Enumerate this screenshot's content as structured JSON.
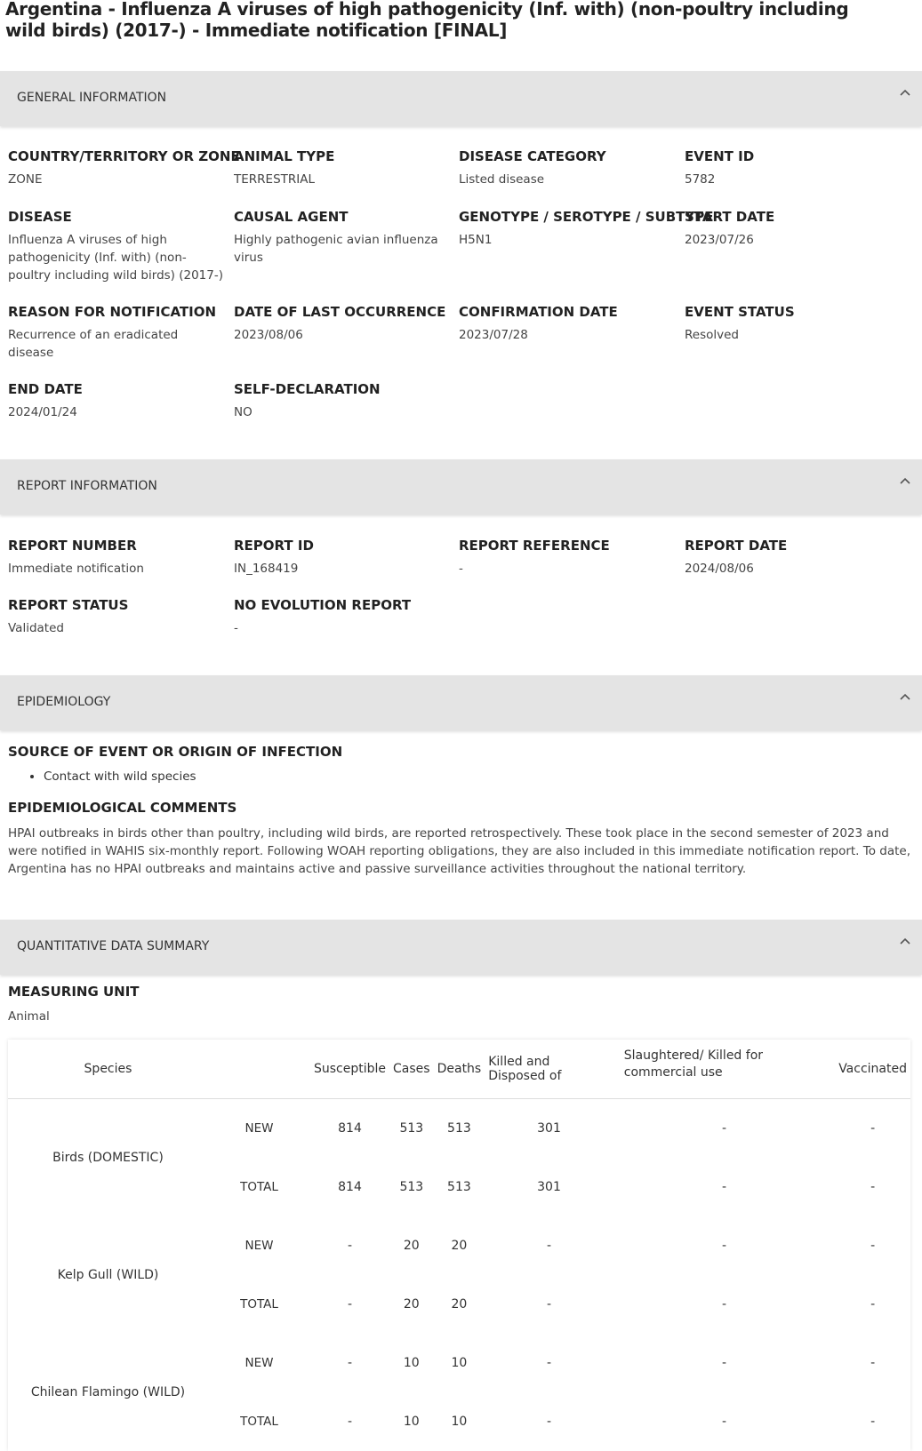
{
  "page": {
    "title": "Argentina - Influenza A viruses of high pathogenicity (Inf. with) (non-poultry including wild birds) (2017-) - Immediate notification [FINAL]"
  },
  "sections": {
    "general": "GENERAL INFORMATION",
    "report": "REPORT INFORMATION",
    "epidemiology": "EPIDEMIOLOGY",
    "quantitative": "QUANTITATIVE DATA SUMMARY"
  },
  "icons": {
    "collapse": "chevron-up-icon",
    "bullet": "bullet-icon"
  },
  "general": {
    "country_label": "COUNTRY/TERRITORY OR ZONE",
    "country_value": "ZONE",
    "animal_type_label": "ANIMAL TYPE",
    "animal_type_value": "TERRESTRIAL",
    "disease_category_label": "DISEASE CATEGORY",
    "disease_category_value": "Listed disease",
    "event_id_label": "EVENT ID",
    "event_id_value": "5782",
    "disease_label": "DISEASE",
    "disease_value": "Influenza A viruses of high pathogenicity (Inf. with) (non-poultry including wild birds) (2017-)",
    "causal_agent_label": "CAUSAL AGENT",
    "causal_agent_value": "Highly pathogenic avian influenza virus",
    "genotype_label": "GENOTYPE / SEROTYPE / SUBTYPE",
    "genotype_value": "H5N1",
    "start_date_label": "START DATE",
    "start_date_value": "2023/07/26",
    "reason_label": "REASON FOR NOTIFICATION",
    "reason_value": "Recurrence of an eradicated disease",
    "last_occurrence_label": "DATE OF LAST OCCURRENCE",
    "last_occurrence_value": "2023/08/06",
    "confirmation_label": "CONFIRMATION DATE",
    "confirmation_value": "2023/07/28",
    "event_status_label": "EVENT STATUS",
    "event_status_value": "Resolved",
    "end_date_label": "END DATE",
    "end_date_value": "2024/01/24",
    "self_declaration_label": "SELF-DECLARATION",
    "self_declaration_value": "NO"
  },
  "report": {
    "number_label": "REPORT NUMBER",
    "number_value": "Immediate notification",
    "id_label": "REPORT ID",
    "id_value": "IN_168419",
    "reference_label": "REPORT REFERENCE",
    "reference_value": "-",
    "date_label": "REPORT DATE",
    "date_value": "2024/08/06",
    "status_label": "REPORT STATUS",
    "status_value": "Validated",
    "no_evolution_label": "NO EVOLUTION REPORT",
    "no_evolution_value": "-"
  },
  "epidemiology": {
    "source_label": "SOURCE OF EVENT OR ORIGIN OF INFECTION",
    "sources": [
      "Contact with wild species"
    ],
    "comments_label": "EPIDEMIOLOGICAL COMMENTS",
    "comments_text": "HPAI outbreaks in birds other than poultry, including wild birds, are reported retrospectively. These took place in the second semester of 2023 and were notified in WAHIS six-monthly report. Following WOAH reporting obligations, they are also included in this immediate notification report. To date, Argentina has no HPAI outbreaks and maintains active and passive surveillance activities throughout the national territory."
  },
  "quantitative": {
    "measuring_unit_label": "MEASURING UNIT",
    "measuring_unit_value": "Animal",
    "headers": {
      "species": "Species",
      "susceptible": "Susceptible",
      "cases": "Cases",
      "deaths": "Deaths",
      "killed": "Killed and Disposed of",
      "slaughtered": "Slaughtered/ Killed for commercial use",
      "vaccinated": "Vaccinated"
    },
    "rows": [
      {
        "species": "Birds (DOMESTIC)",
        "new": {
          "type": "NEW",
          "susceptible": "814",
          "cases": "513",
          "deaths": "513",
          "killed": "301",
          "slaughtered": "-",
          "vaccinated": "-"
        },
        "total": {
          "type": "TOTAL",
          "susceptible": "814",
          "cases": "513",
          "deaths": "513",
          "killed": "301",
          "slaughtered": "-",
          "vaccinated": "-"
        }
      },
      {
        "species": "Kelp Gull (WILD)",
        "new": {
          "type": "NEW",
          "susceptible": "-",
          "cases": "20",
          "deaths": "20",
          "killed": "-",
          "slaughtered": "-",
          "vaccinated": "-"
        },
        "total": {
          "type": "TOTAL",
          "susceptible": "-",
          "cases": "20",
          "deaths": "20",
          "killed": "-",
          "slaughtered": "-",
          "vaccinated": "-"
        }
      },
      {
        "species": "Chilean Flamingo (WILD)",
        "new": {
          "type": "NEW",
          "susceptible": "-",
          "cases": "10",
          "deaths": "10",
          "killed": "-",
          "slaughtered": "-",
          "vaccinated": "-"
        },
        "total": {
          "type": "TOTAL",
          "susceptible": "-",
          "cases": "10",
          "deaths": "10",
          "killed": "-",
          "slaughtered": "-",
          "vaccinated": "-"
        }
      }
    ]
  }
}
